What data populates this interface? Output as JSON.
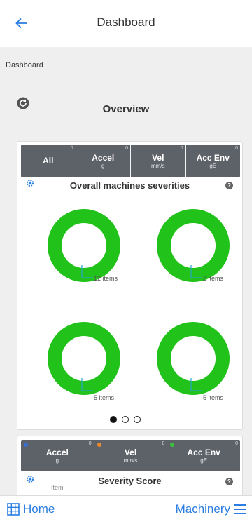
{
  "header": {
    "title": "Dashboard",
    "back_icon": "arrow-left-icon"
  },
  "breadcrumb": {
    "text": "Dashboard"
  },
  "overview": {
    "title": "Overview",
    "refresh_icon": "refresh-icon"
  },
  "severity_card": {
    "title": "Overall machines severities",
    "tabs": [
      {
        "label": "All",
        "unit": "",
        "count": "0"
      },
      {
        "label": "Accel",
        "unit": "g",
        "count": "0"
      },
      {
        "label": "Vel",
        "unit": "mm/s",
        "count": "0"
      },
      {
        "label": "Acc Env",
        "unit": "gE",
        "count": "0"
      }
    ],
    "donuts": [
      {
        "caption": "12 items",
        "value": 12
      },
      {
        "caption": "2 items",
        "value": 2
      },
      {
        "caption": "5 items",
        "value": 5
      },
      {
        "caption": "5 items",
        "value": 5
      }
    ],
    "pager": {
      "pages": 3,
      "active": 1
    }
  },
  "score_card": {
    "title": "Severity Score",
    "item_label": "Item",
    "tabs": [
      {
        "label": "Accel",
        "unit": "g",
        "count": "0",
        "dot_color": "#3b6fd1"
      },
      {
        "label": "Vel",
        "unit": "mm/s",
        "count": "0",
        "dot_color": "#f08a2c"
      },
      {
        "label": "Acc Env",
        "unit": "gE",
        "count": "0",
        "dot_color": "#3cc13c"
      }
    ]
  },
  "bottom_bar": {
    "home_label": "Home",
    "machinery_label": "Machinery"
  },
  "colors": {
    "accent": "#2a7de1",
    "donut": "#21c21a",
    "tab_bg": "#5d6168",
    "indicator": "#2aa6c8"
  }
}
